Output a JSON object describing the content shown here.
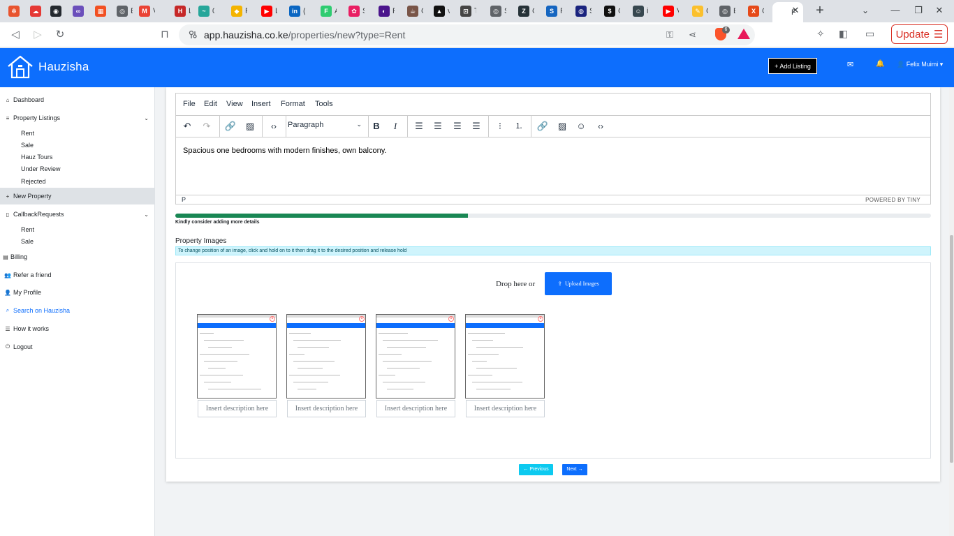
{
  "browser": {
    "tabs": [
      {
        "fav": "✻",
        "color": "#e8542f",
        "title": ""
      },
      {
        "fav": "☁",
        "color": "#e53935",
        "title": ""
      },
      {
        "fav": "◉",
        "color": "#24292f",
        "title": ""
      },
      {
        "fav": "∞",
        "color": "#6b4fbb",
        "title": ""
      },
      {
        "fav": "▦",
        "color": "#f25022",
        "title": ""
      },
      {
        "fav": "◎",
        "color": "#5f6368",
        "title": "B"
      },
      {
        "fav": "M",
        "color": "#ea4335",
        "title": "V"
      },
      {
        "fav": "H",
        "color": "#c62828",
        "title": "L"
      },
      {
        "fav": "~",
        "color": "#26a69a",
        "title": "0"
      },
      {
        "fav": "◆",
        "color": "#f4b400",
        "title": "R"
      },
      {
        "fav": "▶",
        "color": "#ff0000",
        "title": "L"
      },
      {
        "fav": "in",
        "color": "#0a66c2",
        "title": "(i"
      },
      {
        "fav": "F",
        "color": "#2ecc71",
        "title": "A"
      },
      {
        "fav": "✿",
        "color": "#e91e63",
        "title": "S"
      },
      {
        "fav": "◐",
        "color": "#4a148c",
        "title": "F"
      },
      {
        "fav": "☕",
        "color": "#795548",
        "title": "C"
      },
      {
        "fav": "▲",
        "color": "#111111",
        "title": "v"
      },
      {
        "fav": "⊡",
        "color": "#444444",
        "title": "T"
      },
      {
        "fav": "◎",
        "color": "#5f6368",
        "title": "S"
      },
      {
        "fav": "Z",
        "color": "#263238",
        "title": "C"
      },
      {
        "fav": "S",
        "color": "#1565c0",
        "title": "F"
      },
      {
        "fav": "◍",
        "color": "#1a237e",
        "title": "S"
      },
      {
        "fav": "$",
        "color": "#111111",
        "title": "C"
      },
      {
        "fav": "☺",
        "color": "#37474f",
        "title": "in"
      },
      {
        "fav": "▶",
        "color": "#ff0000",
        "title": "V"
      },
      {
        "fav": "✎",
        "color": "#fbc02d",
        "title": "C"
      },
      {
        "fav": "◎",
        "color": "#5f6368",
        "title": "E"
      },
      {
        "fav": "X",
        "color": "#e64a19",
        "title": "C"
      },
      {
        "fav": "",
        "color": "#ffffff",
        "title": "F"
      }
    ],
    "tab_close": "✕",
    "new_tab": "+",
    "tab_menu": "⌄",
    "win_min": "—",
    "win_max": "❐",
    "win_close": "✕",
    "back": "◁",
    "forward": "▷",
    "reload": "↻",
    "bookmark": "⊓",
    "url_host": "app.hauzisha.co.ke",
    "url_path": "/properties/new?type=Rent",
    "key_icon": "⚿",
    "share_icon": "⋖",
    "brave_badge": "6",
    "ext_icon": "✧",
    "sidebar_icon": "◧",
    "wallet_icon": "▭",
    "update_label": "Update",
    "update_icon": "☰"
  },
  "header": {
    "brand": "Hauzisha",
    "add_listing": "+ Add Listing",
    "msg_icon": "✉",
    "bell_icon": "🔔",
    "user": "Felix Muimi"
  },
  "sidebar": {
    "dashboard": "Dashboard",
    "listings": "Property Listings",
    "listings_sub": [
      "Rent",
      "Sale",
      "Hauz Tours",
      "Under Review",
      "Rejected"
    ],
    "new_property": "New Property",
    "callbacks": "CallbackRequests",
    "callbacks_sub": [
      "Rent",
      "Sale"
    ],
    "billing": "Billing",
    "refer": "Refer a friend",
    "profile": "My Profile",
    "search": "Search on Hauzisha",
    "how": "How it works",
    "logout": "Logout"
  },
  "editor": {
    "menus": [
      "File",
      "Edit",
      "View",
      "Insert",
      "Format",
      "Tools"
    ],
    "block_format": "Paragraph",
    "content": "Spacious one bedrooms with modern finishes, own balcony.",
    "path": "P",
    "powered": "POWERED BY TINY"
  },
  "progress": {
    "percent": 38.7,
    "message": "Kindly consider adding more details"
  },
  "images": {
    "title": "Property Images",
    "hint": "To change position of an image, click and hold on to it then drag it to the desired position and release hold",
    "drop_label": "Drop here or",
    "upload_label": "Upload Images",
    "upload_icon": "⇪",
    "description_placeholder": "Insert description here",
    "count": 4
  },
  "nav": {
    "previous": "← Previous",
    "next": "Next →"
  }
}
